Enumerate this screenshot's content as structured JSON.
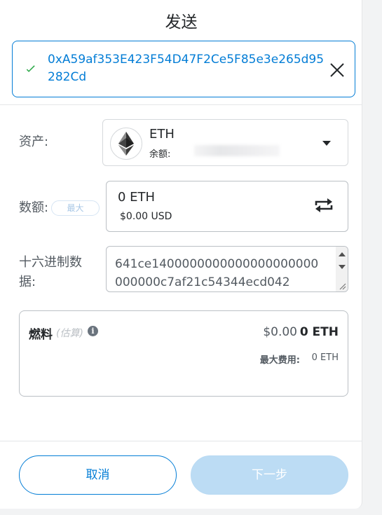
{
  "header": {
    "title": "发送"
  },
  "recipient": {
    "address": "0xA59af353E423F54D47F2Ce5F85e3e265d95282Cd"
  },
  "asset": {
    "label": "资产:",
    "symbol": "ETH",
    "balance_label": "余额:",
    "icon": "ethereum-logo-icon"
  },
  "amount": {
    "label": "数额:",
    "max_label": "最大",
    "value": "0 ETH",
    "fiat": "$0.00 USD"
  },
  "hex": {
    "label": "十六进制数据:",
    "value": "641ce1400000000000000000000000000c7af21c54344ecd042"
  },
  "gas": {
    "title": "燃料",
    "estimate_label": "(估算)",
    "fiat": "$0.00",
    "eth": "0 ETH",
    "max_fee_label": "最大费用:",
    "max_fee_value": "0 ETH"
  },
  "footer": {
    "cancel_label": "取消",
    "next_label": "下一步"
  },
  "colors": {
    "primary": "#037dd6",
    "success": "#28a745",
    "disabled_button": "#bcdcf4"
  }
}
